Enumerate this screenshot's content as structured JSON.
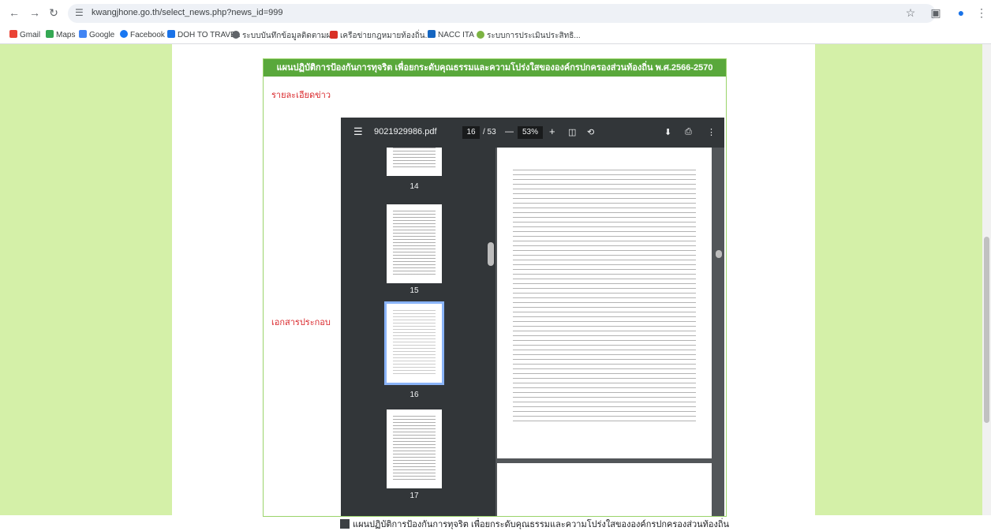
{
  "browser": {
    "url": "kwangjhone.go.th/select_news.php?news_id=999",
    "icons": {
      "back": "arrow-left-icon",
      "forward": "arrow-right-icon",
      "reload": "reload-icon",
      "site_info": "tune-icon",
      "star": "star-icon",
      "extensions": "puzzle-icon",
      "profile": "profile-icon",
      "menu": "more-vert-icon"
    }
  },
  "bookmarks": [
    {
      "label": "Gmail",
      "color": "#ea4335"
    },
    {
      "label": "Maps",
      "color": "#34a853"
    },
    {
      "label": "Google",
      "color": "#4285f4"
    },
    {
      "label": "Facebook",
      "color": "#1877f2"
    },
    {
      "label": "DOH TO TRAVEL",
      "color": "#1a73e8"
    },
    {
      "label": "ระบบบันทึกข้อมูลติดตามผ...",
      "color": "#5f6368"
    },
    {
      "label": "เครือข่ายกฎหมายท้องถิ่น...",
      "color": "#d93025"
    },
    {
      "label": "NACC ITA",
      "color": "#1565c0"
    },
    {
      "label": "ระบบการประเมินประสิทธิ...",
      "color": "#7cb342"
    }
  ],
  "colors": {
    "side_panel": "#d4f0a8",
    "header_bar": "#59a83b",
    "label_red": "#d9262a",
    "pdf_dark": "#323639"
  },
  "card": {
    "header": "แผนปฏิบัติการป้องกันการทุจริต เพื่อยกระดับคุณธรรมและความโปร่งใสขององค์กรปกครองส่วนท้องถิ่น พ.ศ.2566-2570",
    "news_label": "รายละเอียดข่าว",
    "attachment_label": "เอกสารประกอบ",
    "footer_file_title": "แผนปฏิบัติการป้องกันการทุจริต เพื่อยกระดับคุณธรรมและความโปร่งใสขององค์กรปกครองส่วนท้องถิ่น"
  },
  "pdf": {
    "filename": "9021929986.pdf",
    "current_page": "16",
    "page_sep": "/ 53",
    "zoom": "53%",
    "thumbnails": [
      "14",
      "15",
      "16",
      "17"
    ],
    "selected_thumbnail": "16"
  }
}
